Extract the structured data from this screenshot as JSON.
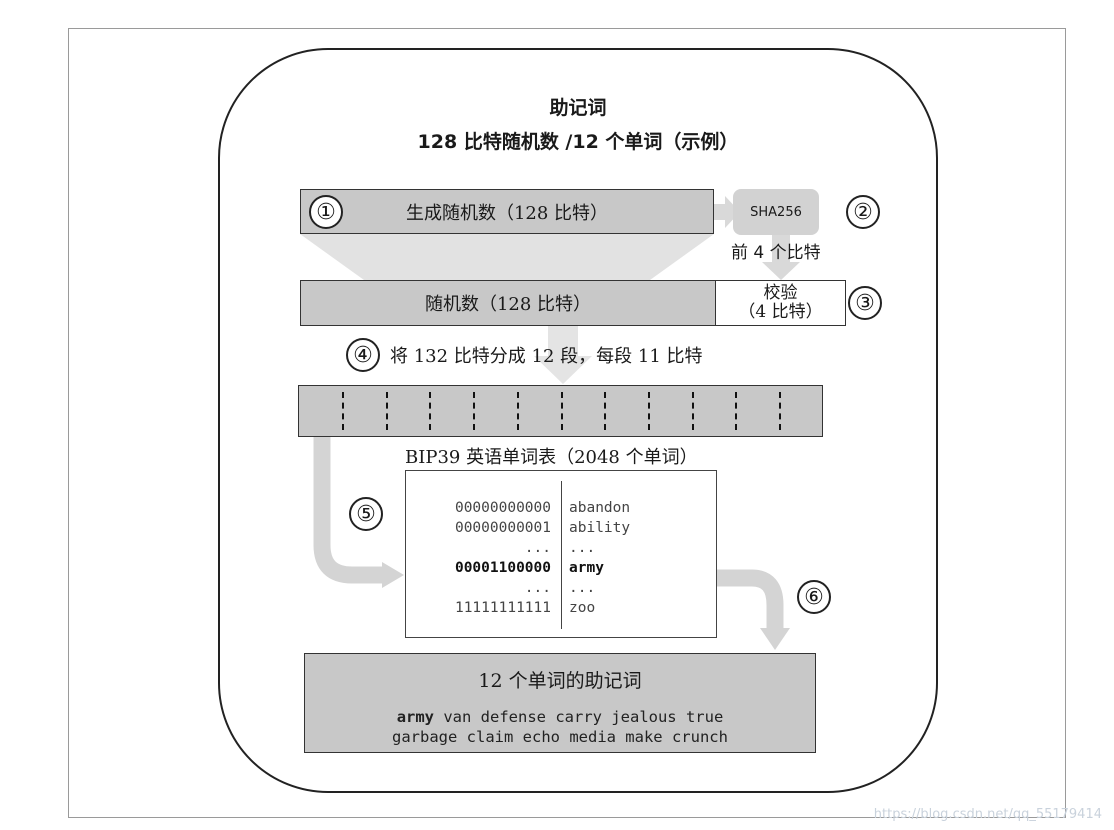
{
  "title": {
    "line1": "助记词",
    "line2": "128 比特随机数 /12 个单词（示例）"
  },
  "steps": {
    "s1": "①",
    "s2": "②",
    "s3": "③",
    "s4": "④",
    "s5": "⑤",
    "s6": "⑥"
  },
  "generate_box": "生成随机数（128 比特）",
  "sha_box": "SHA256",
  "first4_label": "前 4 个比特",
  "random_box": "随机数（128 比特）",
  "checksum_box": {
    "line1": "校验",
    "line2": "（4 比特）"
  },
  "split_label": "将 132 比特分成 12 段，每段 11 比特",
  "wordlist_title": "BIP39 英语单词表（2048 个单词）",
  "wordlist": {
    "rows": [
      {
        "bits": "00000000000",
        "word": "abandon",
        "bold": false
      },
      {
        "bits": "00000000001",
        "word": "ability",
        "bold": false
      },
      {
        "bits": "...",
        "word": "...",
        "bold": false
      },
      {
        "bits": "00001100000",
        "word": "army",
        "bold": true
      },
      {
        "bits": "...",
        "word": "...",
        "bold": false
      },
      {
        "bits": "11111111111",
        "word": "zoo",
        "bold": false
      }
    ]
  },
  "mnemonic": {
    "title": "12 个单词的助记词",
    "first_word": "army",
    "line1_rest": " van defense carry jealous true",
    "line2": "garbage claim echo media make crunch"
  },
  "watermark": "https://blog.csdn.net/qq_55179414",
  "colors": {
    "box_fill": "#c8c8c8",
    "arrow_fill": "#d9d9d9",
    "funnel_fill": "#e2e2e2"
  }
}
